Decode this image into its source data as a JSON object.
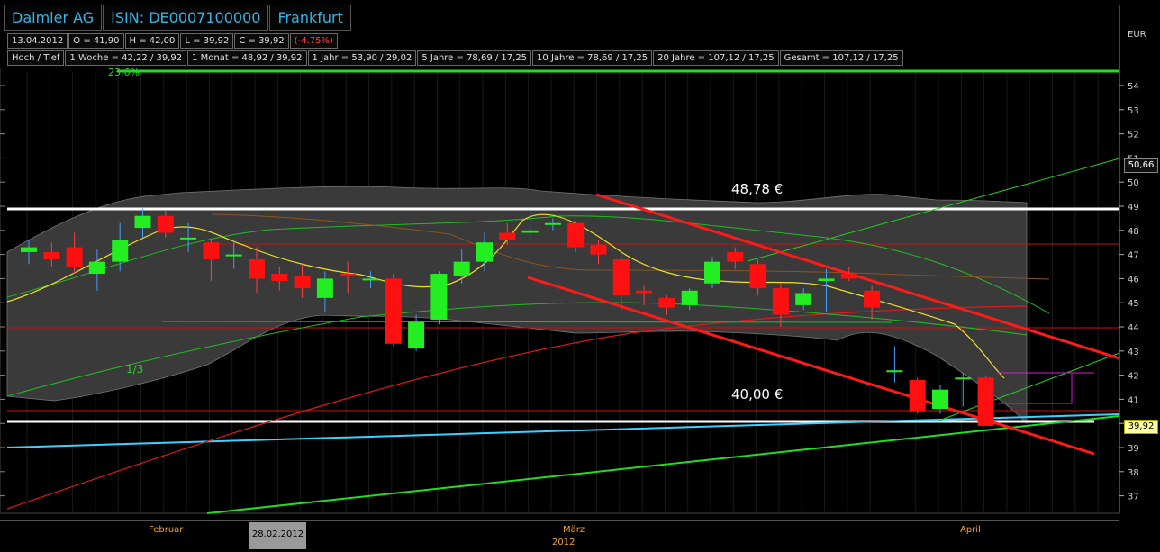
{
  "header": {
    "title": "Daimler AG",
    "isin": "ISIN: DE0007100000",
    "exchange": "Frankfurt"
  },
  "quote_row": {
    "date": "13.04.2012",
    "open": "O = 41,90",
    "high": "H = 42,00",
    "low": "L = 39,92",
    "close": "C = 39,92",
    "change": "(-4.75%)"
  },
  "range_row": [
    "Hoch / Tief",
    "1 Woche = 42,22 / 39,92",
    "1 Monat = 48,92 / 39,92",
    "1 Jahr = 53,90 / 29,02",
    "5 Jahre = 78,69 / 17,25",
    "10 Jahre = 78,69 / 17,25",
    "20 Jahre = 107,12 / 17,25",
    "Gesamt = 107,12 / 17,25"
  ],
  "currency": "EUR",
  "price_tags": {
    "upper": "50,66",
    "last": "39,92"
  },
  "annotations": {
    "resistance": "48,78 €",
    "support": "40,00 €",
    "fib_top": "23,6%",
    "fraction": "1/3"
  },
  "x_axis": {
    "months": [
      "Februar",
      "März",
      "April"
    ],
    "year": "2012",
    "selected_date": "28.02.2012"
  },
  "colors": {
    "up": "#22ee22",
    "down": "#ff1010",
    "band": "#3a3a3a",
    "header_text": "#35b5e5",
    "label": "#f0a040"
  },
  "chart_data": {
    "type": "candlestick",
    "ylim": [
      36.3,
      54.8
    ],
    "y_ticks": [
      "37",
      "38",
      "39",
      "40",
      "41",
      "42",
      "43",
      "44",
      "45",
      "46",
      "47",
      "48",
      "49",
      "50",
      "51",
      "52",
      "53",
      "54"
    ],
    "candles": [
      {
        "o": 47.1,
        "c": 47.3,
        "h": 47.6,
        "l": 46.6
      },
      {
        "o": 47.1,
        "c": 46.8,
        "h": 47.5,
        "l": 46.5
      },
      {
        "o": 47.3,
        "c": 46.5,
        "h": 47.9,
        "l": 46.2
      },
      {
        "o": 46.2,
        "c": 46.7,
        "h": 47.2,
        "l": 45.5
      },
      {
        "o": 46.7,
        "c": 47.6,
        "h": 48.3,
        "l": 46.3
      },
      {
        "o": 48.1,
        "c": 48.6,
        "h": 48.9,
        "l": 47.7
      },
      {
        "o": 48.6,
        "c": 47.9,
        "h": 48.8,
        "l": 47.7
      },
      {
        "o": 47.7,
        "c": 47.7,
        "h": 48.3,
        "l": 47.1
      },
      {
        "o": 47.5,
        "c": 46.8,
        "h": 47.6,
        "l": 45.9
      },
      {
        "o": 47.0,
        "c": 47.0,
        "h": 47.6,
        "l": 46.4
      },
      {
        "o": 46.8,
        "c": 46.0,
        "h": 47.3,
        "l": 45.4
      },
      {
        "o": 46.2,
        "c": 45.9,
        "h": 46.5,
        "l": 45.5
      },
      {
        "o": 46.1,
        "c": 45.6,
        "h": 46.6,
        "l": 45.2
      },
      {
        "o": 45.2,
        "c": 46.0,
        "h": 46.3,
        "l": 44.6
      },
      {
        "o": 46.2,
        "c": 46.1,
        "h": 46.7,
        "l": 45.4
      },
      {
        "o": 46.0,
        "c": 46.0,
        "h": 46.3,
        "l": 45.6
      },
      {
        "o": 46.0,
        "c": 43.3,
        "h": 46.2,
        "l": 43.2
      },
      {
        "o": 43.1,
        "c": 44.2,
        "h": 44.5,
        "l": 43.0
      },
      {
        "o": 44.3,
        "c": 46.2,
        "h": 46.3,
        "l": 44.1
      },
      {
        "o": 46.1,
        "c": 46.7,
        "h": 47.2,
        "l": 45.8
      },
      {
        "o": 46.7,
        "c": 47.5,
        "h": 47.9,
        "l": 46.3
      },
      {
        "o": 47.9,
        "c": 47.6,
        "h": 48.3,
        "l": 47.4
      },
      {
        "o": 47.9,
        "c": 48.0,
        "h": 48.9,
        "l": 47.6
      },
      {
        "o": 48.3,
        "c": 48.3,
        "h": 48.5,
        "l": 48.0
      },
      {
        "o": 48.3,
        "c": 47.3,
        "h": 48.4,
        "l": 47.1
      },
      {
        "o": 47.4,
        "c": 47.0,
        "h": 47.6,
        "l": 46.6
      },
      {
        "o": 46.8,
        "c": 45.3,
        "h": 47.0,
        "l": 44.7
      },
      {
        "o": 45.5,
        "c": 45.4,
        "h": 45.7,
        "l": 44.9
      },
      {
        "o": 45.2,
        "c": 44.8,
        "h": 45.3,
        "l": 44.5
      },
      {
        "o": 44.9,
        "c": 45.5,
        "h": 45.6,
        "l": 44.7
      },
      {
        "o": 45.8,
        "c": 46.7,
        "h": 46.9,
        "l": 45.6
      },
      {
        "o": 47.1,
        "c": 46.7,
        "h": 47.3,
        "l": 46.4
      },
      {
        "o": 46.6,
        "c": 45.6,
        "h": 46.8,
        "l": 45.3
      },
      {
        "o": 45.6,
        "c": 44.5,
        "h": 45.8,
        "l": 44.0
      },
      {
        "o": 44.9,
        "c": 45.4,
        "h": 45.6,
        "l": 44.7
      },
      {
        "o": 45.9,
        "c": 46.0,
        "h": 46.4,
        "l": 44.6
      },
      {
        "o": 46.2,
        "c": 46.0,
        "h": 46.5,
        "l": 45.9
      },
      {
        "o": 45.5,
        "c": 44.8,
        "h": 45.7,
        "l": 44.3
      },
      {
        "o": 42.2,
        "c": 42.2,
        "h": 43.2,
        "l": 41.7
      },
      {
        "o": 41.8,
        "c": 40.5,
        "h": 41.9,
        "l": 40.4
      },
      {
        "o": 40.6,
        "c": 41.4,
        "h": 41.6,
        "l": 40.4
      },
      {
        "o": 41.9,
        "c": 41.9,
        "h": 42.1,
        "l": 40.7
      },
      {
        "o": 41.9,
        "c": 39.9,
        "h": 42.0,
        "l": 39.9
      }
    ]
  }
}
